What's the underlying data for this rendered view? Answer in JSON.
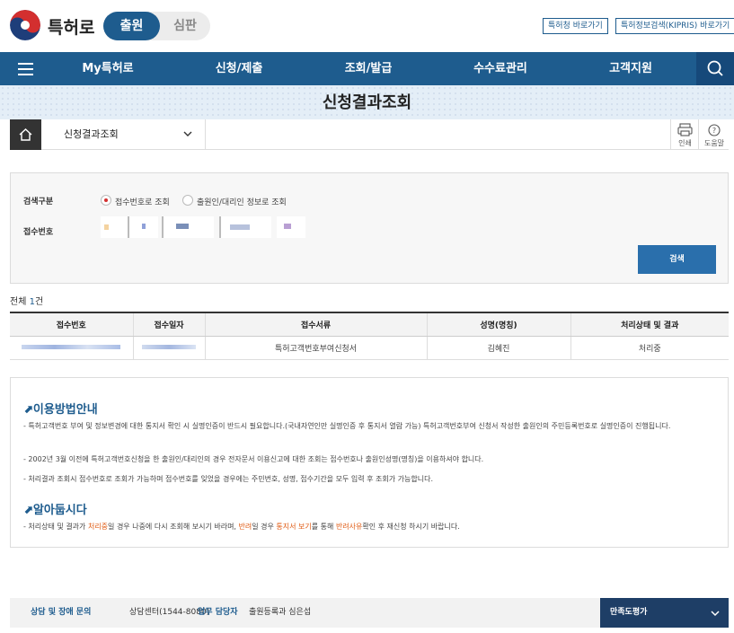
{
  "header": {
    "logo_text": "특허로",
    "seg_on": "출원",
    "seg_off": "심판",
    "ext_links": [
      "특허청 바로가기",
      "특허정보검색(KIPRIS) 바로가기"
    ]
  },
  "nav": {
    "items": [
      "My특허로",
      "신청/제출",
      "조회/발급",
      "수수료관리",
      "고객지원"
    ]
  },
  "page": {
    "title": "신청결과조회"
  },
  "breadcrumb": {
    "current": "신청결과조회",
    "print_label": "인쇄",
    "help_label": "도움말"
  },
  "search": {
    "type_label": "검색구분",
    "options": [
      "접수번호로 조회",
      "출원인/대리인 정보로 조회"
    ],
    "selected_option": "접수번호로 조회",
    "receipt_label": "접수번호",
    "button_label": "검색"
  },
  "results": {
    "total_prefix": "전체 ",
    "total_count": "1",
    "total_suffix": "건",
    "columns": [
      "접수번호",
      "접수일자",
      "접수서류",
      "성명(명칭)",
      "처리상태 및 결과"
    ],
    "rows": [
      {
        "doc": "특허고객번호부여신청서",
        "name": "김혜진",
        "status": "처리중"
      }
    ]
  },
  "info": {
    "heading1": "이용방법안내",
    "bullets1": [
      "- 특허고객번호 부여 및 정보변경에 대한 통지서 확인 시 실명인증이 반드시 필요합니다.(국내자연인만 실명인증 후 통지서 열람 가능) 특허고객번호부여 신청서 작성한 출원인의 주민등록번호로 실명인증이 진행됩니다.",
      "- 2002년 3월 이전에 특허고객번호신청을 한 출원인/대리인의 경우 전자문서 이용신고에 대한 조회는 접수번호나 출원인성명(명칭)을 이용하셔야 합니다.",
      "- 처리결과 조회시 접수번호로 조회가 가능하며 접수번호를 잊었을 경우에는 주민번호, 성명, 접수기간을 모두 입력 후 조회가 가능합니다."
    ],
    "heading2": "알아둡시다",
    "notice": {
      "p1": "- 처리상태 및 결과가 ",
      "h1": "처리중",
      "p2": "일 경우 나중에 다시 조회해 보시기 바라며, ",
      "h2": "반려",
      "p3": "일 경우 ",
      "h3": "통지서 보기",
      "p4": "를 통해 ",
      "h4": "반려사유",
      "p5": "확인 후 재신청 하시기 바랍니다."
    }
  },
  "footer": {
    "consult_label": "상담 및 장애 문의",
    "consult_value": "상담센터(1544-8080)",
    "staff_label": "업무 담당자",
    "staff_value": "출원등록과 심은섭",
    "survey_label": "만족도평가"
  },
  "colors": {
    "primary": "#1e5c8e",
    "highlight": "#e05a12",
    "footer_dark": "#1e3e66"
  },
  "icons": [
    "menu-icon",
    "search-icon",
    "home-icon",
    "chevron-down-icon",
    "print-icon",
    "help-icon"
  ]
}
